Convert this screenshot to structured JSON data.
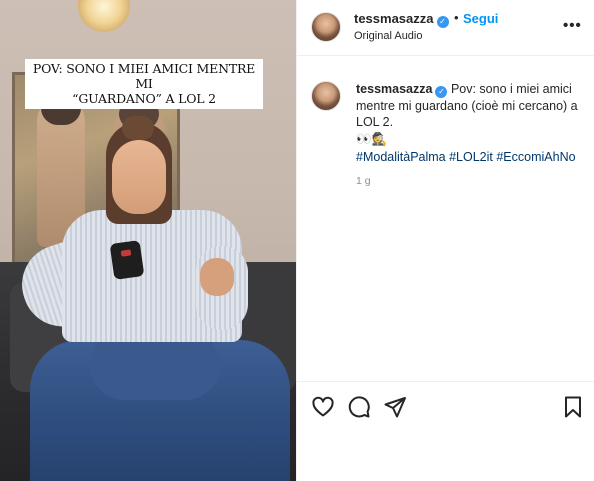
{
  "post": {
    "overlay_caption_line1": "POV: SONO I MIEI AMICI MENTRE MI",
    "overlay_caption_line2": "“GUARDANO” A LOL 2"
  },
  "header": {
    "username": "tessmasazza",
    "separator": "•",
    "follow_label": "Segui",
    "audio_label": "Original Audio",
    "more_label": "•••"
  },
  "comment": {
    "username": "tessmasazza",
    "text": "Pov: sono i miei amici mentre mi guardano (cioè mi cercano) a LOL 2.",
    "emojis": "👀🕵️",
    "hashtags": "#ModalitàPalma #LOL2it #EccomiAhNo",
    "timestamp": "1 g"
  },
  "actions": {
    "icons": [
      "heart-icon",
      "comment-icon",
      "share-icon",
      "bookmark-icon"
    ]
  },
  "colors": {
    "accent": "#0095f6",
    "verified": "#3897f0",
    "hashtag": "#00376b",
    "text": "#262626",
    "muted": "#8e8e8e"
  }
}
